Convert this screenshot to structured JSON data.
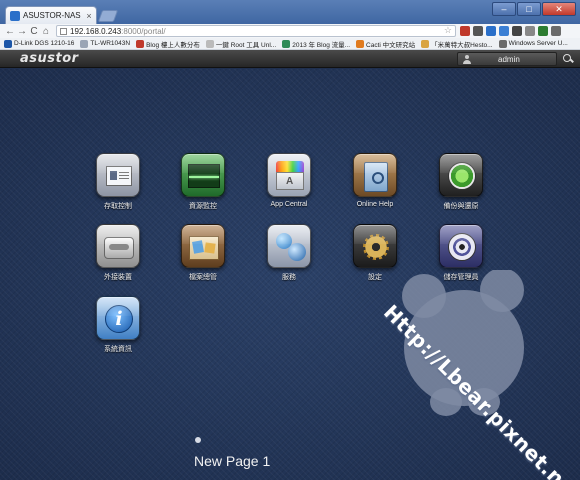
{
  "browser": {
    "tab_title": "ASUSTOR-NAS",
    "tab_close": "×",
    "window_controls": [
      "–",
      "□",
      "✕"
    ],
    "nav": [
      "←",
      "→",
      "C",
      "⌂"
    ],
    "url_host": "192.168.0.243",
    "url_rest": ":8000/portal/",
    "bookmarks": [
      {
        "label": "D-Link DGS 1210-16",
        "color": "#1c56a8"
      },
      {
        "label": "TL-WR1043N",
        "color": "#9aa5b5"
      },
      {
        "label": "Blog 樓上人數分布",
        "color": "#c0392b"
      },
      {
        "label": "一鍵 Root 工具 Unl...",
        "color": "#bbbbbb"
      },
      {
        "label": "2013 年 Blog 流量...",
        "color": "#2e8b57"
      },
      {
        "label": "Cacti 中文研究站",
        "color": "#e07b1f"
      },
      {
        "label": "「米萬特大叔Hesto...",
        "color": "#d9a441"
      },
      {
        "label": "Windows Server U...",
        "color": "#6b6b6b"
      }
    ],
    "extension_colors": [
      "#c0392b",
      "#555555",
      "#2a6fc9",
      "#3b7fd4",
      "#444444",
      "#888888",
      "#2e7d32",
      "#6b6b6b"
    ]
  },
  "header": {
    "logo": "asustor",
    "username": "admin"
  },
  "apps": [
    {
      "label": "存取控制",
      "icon": "access-control-icon"
    },
    {
      "label": "資源監控",
      "icon": "activity-monitor-icon"
    },
    {
      "label": "App Central",
      "icon": "app-central-icon"
    },
    {
      "label": "Online Help",
      "icon": "online-help-icon"
    },
    {
      "label": "備份與還原",
      "icon": "backup-restore-icon"
    },
    {
      "label": "外接裝置",
      "icon": "external-devices-icon"
    },
    {
      "label": "檔案總管",
      "icon": "file-explorer-icon"
    },
    {
      "label": "服務",
      "icon": "services-icon"
    },
    {
      "label": "設定",
      "icon": "settings-gear-icon"
    },
    {
      "label": "儲存管理員",
      "icon": "storage-manager-icon"
    },
    {
      "label": "系統資訊",
      "icon": "system-information-icon"
    }
  ],
  "pager": {
    "label": "New Page 1"
  },
  "watermark": "Http://Lbear.pixnet.net"
}
